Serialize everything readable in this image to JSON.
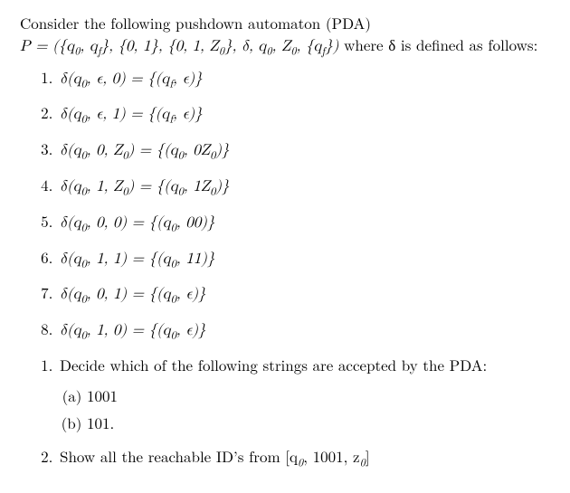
{
  "intro_line1": "Consider the following pushdown automaton (PDA)",
  "intro_line2_pre": "P = ({q",
  "intro_line2_q0sub": "0",
  "intro_line2_mid1": ", q",
  "intro_line2_qfsub": "f",
  "intro_line2_mid2": "}, {0, 1}, {0, 1, Z",
  "intro_line2_z0sub": "0",
  "intro_line2_mid3": "}, δ, q",
  "intro_line2_q0sub2": "0",
  "intro_line2_mid4": ", Z",
  "intro_line2_z0sub2": "0",
  "intro_line2_mid5": ", {q",
  "intro_line2_qfsub2": "f",
  "intro_line2_end": "})",
  "intro_where": " where δ is defined as follows:",
  "delta_rules": [
    "δ(q₀, ϵ, 0) = {(qf, ϵ)}",
    "δ(q₀, ϵ, 1) = {(qf, ϵ)}",
    "δ(q₀, 0, Z₀) = {(q₀, 0Z₀)}",
    "δ(q₀, 1, Z₀) = {(q₀, 1Z₀)}",
    "δ(q₀, 0, 0) = {(q₀, 00)}",
    "δ(q₀, 1, 1) = {(q₀, 11)}",
    "δ(q₀, 0, 1) = {(q₀, ϵ)}",
    "δ(q₀, 1, 0) = {(q₀, ϵ)}"
  ],
  "task1": "Decide which of the following strings are accepted by the PDA:",
  "task1_items": [
    "1001",
    "101."
  ],
  "task2_pre": "Show all the reachable ID’s from [q",
  "task2_sub": "0",
  "task2_mid": ", 1001, z",
  "task2_sub2": "0",
  "task2_end": "]"
}
